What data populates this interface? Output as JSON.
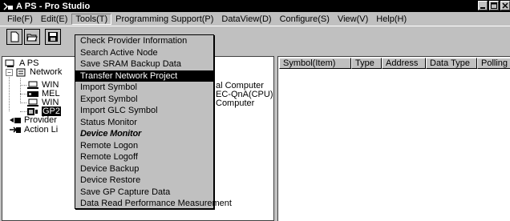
{
  "window": {
    "title": "A PS - Pro Studio"
  },
  "menubar": [
    {
      "label": "File(F)",
      "key": "file"
    },
    {
      "label": "Edit(E)",
      "key": "edit"
    },
    {
      "label": "Tools(T)",
      "key": "tools"
    },
    {
      "label": "Programming Support(P)",
      "key": "programming-support"
    },
    {
      "label": "DataView(D)",
      "key": "dataview"
    },
    {
      "label": "Configure(S)",
      "key": "configure"
    },
    {
      "label": "View(V)",
      "key": "view"
    },
    {
      "label": "Help(H)",
      "key": "help"
    }
  ],
  "tools_menu": [
    {
      "label": "Check Provider Information"
    },
    {
      "label": "Search Active Node"
    },
    {
      "label": "Save SRAM Backup Data"
    },
    {
      "label": "Transfer Network Project",
      "highlighted": true
    },
    {
      "label": "Import Symbol"
    },
    {
      "label": "Export Symbol"
    },
    {
      "label": "Import GLC Symbol"
    },
    {
      "label": "Status Monitor"
    },
    {
      "label": "Device Monitor",
      "style": "bold"
    },
    {
      "label": "Remote Logon"
    },
    {
      "label": "Remote Logoff"
    },
    {
      "label": "Device Backup"
    },
    {
      "label": "Device Restore"
    },
    {
      "label": "Save GP Capture Data"
    },
    {
      "label": "Data Read Performance Measurement"
    }
  ],
  "tree": {
    "root": "A PS",
    "network": "Network",
    "nodes": [
      "WIN",
      "MEL",
      "WIN",
      "GP2"
    ],
    "node_suffixes": [
      "al Computer",
      "EC-QnA(CPU)",
      "Computer",
      ""
    ],
    "provider": "Provider",
    "action": "Action Li"
  },
  "columns": [
    "Symbol(Item)",
    "Type",
    "Address",
    "Data Type",
    "Polling T"
  ]
}
